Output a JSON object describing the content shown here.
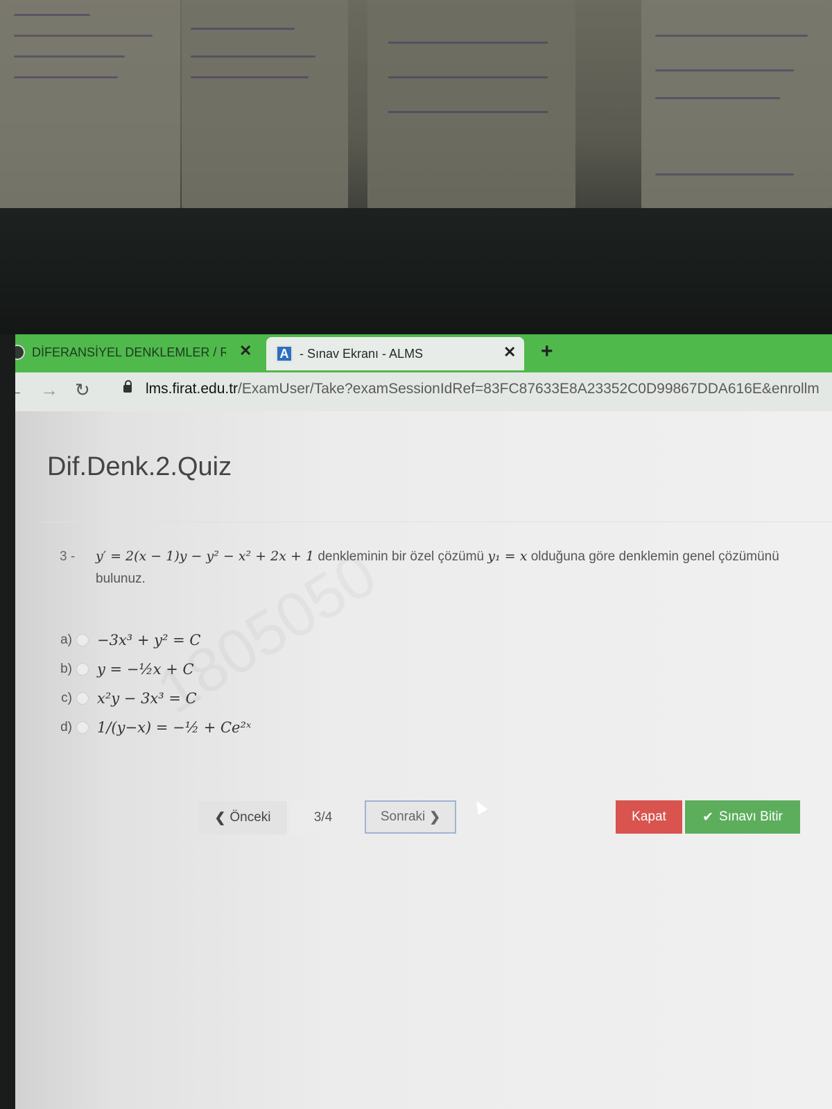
{
  "browser": {
    "tabs": [
      {
        "label": "DİFERANSİYEL DENKLEMLER / R",
        "active": false
      },
      {
        "label": "- Sınav Ekranı - ALMS",
        "active": true
      }
    ],
    "new_tab_label": "+",
    "url_host": "lms.firat.edu.tr",
    "url_path": "/ExamUser/Take?examSessionIdRef=83FC87633E8A23352C0D99867DDA616E&enrollm"
  },
  "exam": {
    "title": "Dif.Denk.2.Quiz",
    "question": {
      "number": "3 -",
      "equation": "y′ = 2(x − 1)y − y² − x² + 2x + 1",
      "text_mid": " denkleminin bir özel çözümü ",
      "particular": "y₁ = x",
      "text_end": " olduğuna göre denklemin genel çözümünü bulunuz."
    },
    "options": [
      {
        "letter": "a)",
        "text": "−3x³ + y² = C"
      },
      {
        "letter": "b)",
        "text": "y = −½x + C"
      },
      {
        "letter": "c)",
        "text": "x²y − 3x³ = C"
      },
      {
        "letter": "d)",
        "text": "1/(y−x) = −½ + Ce²ˣ"
      }
    ],
    "watermark": "1805050"
  },
  "controls": {
    "prev_label": "Önceki",
    "page_indicator": "3/4",
    "next_label": "Sonraki",
    "close_label": "Kapat",
    "finish_label": "Sınavı Bitir"
  },
  "colors": {
    "tabbar": "#4fb94c",
    "close_button": "#d9534f",
    "finish_button": "#5cae5c"
  }
}
